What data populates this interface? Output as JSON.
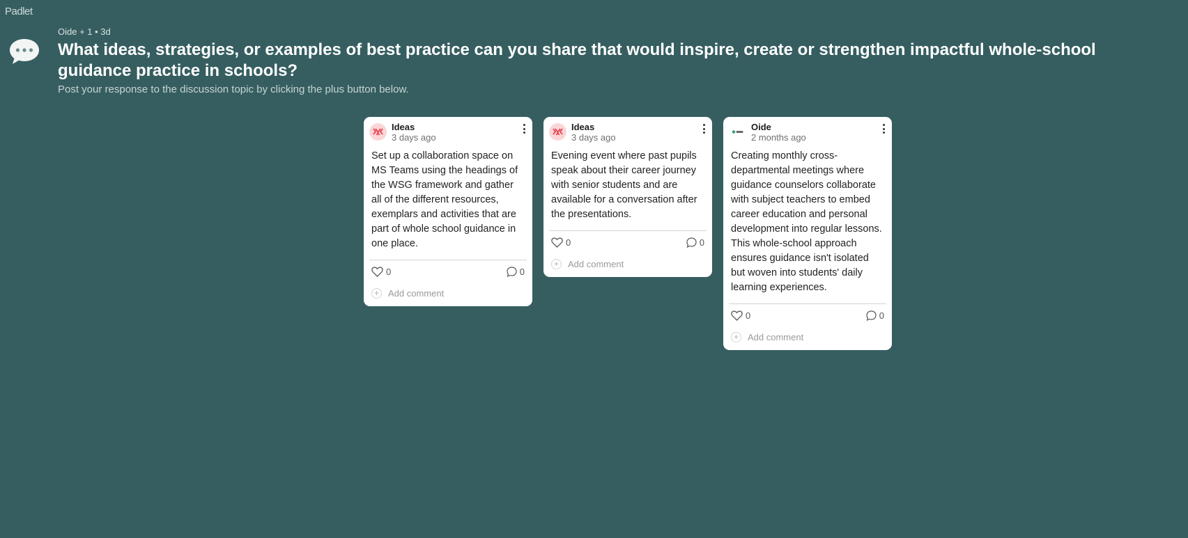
{
  "app": {
    "logo": "Padlet"
  },
  "header": {
    "meta": "Oide + 1 • 3d",
    "title": "What ideas, strategies, or examples of best practice can you share that would inspire, create or strengthen impactful whole-school guidance practice in schools?",
    "subtitle": "Post your response to the discussion topic by clicking the plus button below.",
    "icon": "speech-bubble-icon"
  },
  "posts": [
    {
      "author": "Ideas",
      "time": "3 days ago",
      "body": "Set up a collaboration space on MS Teams using the headings of the WSG framework and gather all of the different resources, exemplars and activities that are part of whole school guidance in one place.",
      "likes": "0",
      "comments": "0",
      "add_comment": "Add comment"
    },
    {
      "author": "Ideas",
      "time": "3 days ago",
      "body": "Evening event where past pupils speak about their career journey with senior students and are available for a conversation after the presentations.",
      "likes": "0",
      "comments": "0",
      "add_comment": "Add comment"
    },
    {
      "author": "Oide",
      "time": "2 months ago",
      "body": "Creating monthly cross-departmental meetings where guidance counselors collaborate with subject teachers to embed career education and personal development into regular lessons. This whole-school approach ensures guidance isn't isolated but woven into students' daily learning experiences.",
      "likes": "0",
      "comments": "0",
      "add_comment": "Add comment"
    }
  ],
  "colors": {
    "background": "#365e60",
    "card": "#ffffff",
    "ideas_avatar": "#e8414b"
  }
}
